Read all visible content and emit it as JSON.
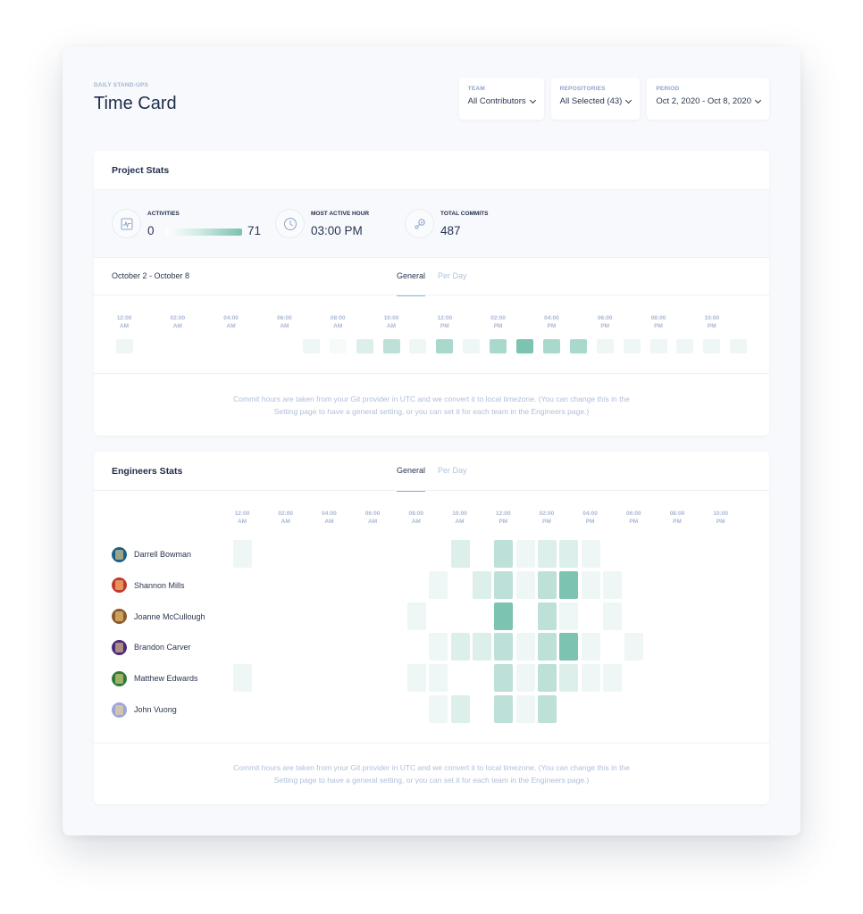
{
  "header": {
    "eyebrow": "DAILY STAND-UPS",
    "title": "Time Card"
  },
  "filters": [
    {
      "label": "TEAM",
      "value": "All Contributors",
      "icon": "chevron-down-icon"
    },
    {
      "label": "REPOSITORIES",
      "value": "All Selected (43)",
      "icon": "chevron-down-icon"
    },
    {
      "label": "PERIOD",
      "value": "Oct 2, 2020 - Oct 8, 2020",
      "icon": "chevron-down-icon"
    }
  ],
  "project_stats": {
    "title": "Project Stats",
    "stats": [
      {
        "label": "ACTIVITIES",
        "icon": "activity-icon",
        "min": "0",
        "max": "71"
      },
      {
        "label": "MOST ACTIVE HOUR",
        "icon": "clock-icon",
        "value": "03:00 PM"
      },
      {
        "label": "TOTAL COMMITS",
        "icon": "commit-icon",
        "value": "487"
      }
    ],
    "range_label": "October 2 - October 8",
    "tabs": [
      {
        "label": "General",
        "active": true
      },
      {
        "label": "Per Day",
        "active": false
      }
    ],
    "note": "Commit hours are taken from your Git provider in UTC and we convert it to local timezone. (You can change this in the Setting page to have a general setting, or you can set it for each team in the Engineers page.)"
  },
  "engineers_stats": {
    "title": "Engineers Stats",
    "tabs": [
      {
        "label": "General",
        "active": true
      },
      {
        "label": "Per Day",
        "active": false
      }
    ],
    "note": "Commit hours are taken from your Git provider in UTC and we convert it to local timezone. (You can change this in the Setting page to have a general setting, or you can set it for each team in the Engineers page.)"
  },
  "colors": {
    "accent": "#7dbbe6",
    "heat_levels": [
      "#ffffff",
      "#eef7f5",
      "#dcefeb",
      "#bde0d8",
      "#a9d8cd",
      "#7cc3b2"
    ]
  },
  "chart_data": [
    {
      "type": "heatmap",
      "title": "Project Stats — activity by hour (General)",
      "x_tick_labels": [
        [
          "12:00",
          "AM"
        ],
        [
          "02:00",
          "AM"
        ],
        [
          "04:00",
          "AM"
        ],
        [
          "06:00",
          "AM"
        ],
        [
          "08:00",
          "AM"
        ],
        [
          "10:00",
          "AM"
        ],
        [
          "12:00",
          "PM"
        ],
        [
          "02:00",
          "PM"
        ],
        [
          "04:00",
          "PM"
        ],
        [
          "06:00",
          "PM"
        ],
        [
          "08:00",
          "PM"
        ],
        [
          "10:00",
          "PM"
        ]
      ],
      "x": [
        "12 AM",
        "1 AM",
        "2 AM",
        "3 AM",
        "4 AM",
        "5 AM",
        "6 AM",
        "7 AM",
        "8 AM",
        "9 AM",
        "10 AM",
        "11 AM",
        "12 PM",
        "1 PM",
        "2 PM",
        "3 PM",
        "4 PM",
        "5 PM",
        "6 PM",
        "7 PM",
        "8 PM",
        "9 PM",
        "10 PM",
        "11 PM"
      ],
      "level_scale": "0 (none) to 5 (max activity, 71)",
      "values": [
        1,
        0,
        0,
        0,
        0,
        0,
        0,
        1,
        0.5,
        1.5,
        3,
        1,
        3.5,
        1,
        3.5,
        5,
        4,
        3.5,
        1,
        1,
        1,
        1,
        1,
        1
      ]
    },
    {
      "type": "heatmap",
      "title": "Engineers Stats — activity by hour (General)",
      "x_tick_labels": [
        [
          "12:00",
          "AM"
        ],
        [
          "02:00",
          "AM"
        ],
        [
          "04:00",
          "AM"
        ],
        [
          "06:00",
          "AM"
        ],
        [
          "08:00",
          "AM"
        ],
        [
          "10:00",
          "AM"
        ],
        [
          "12:00",
          "PM"
        ],
        [
          "02:00",
          "PM"
        ],
        [
          "04:00",
          "PM"
        ],
        [
          "06:00",
          "PM"
        ],
        [
          "08:00",
          "PM"
        ],
        [
          "10:00",
          "PM"
        ]
      ],
      "level_scale": "0 (none) to 5 (max activity)",
      "series": [
        {
          "name": "Darrell Bowman",
          "avatar": "#1f5f86",
          "values": [
            1,
            0,
            0,
            0,
            0,
            0,
            0,
            0,
            0,
            0,
            2,
            0,
            3,
            1,
            2,
            2,
            1,
            0,
            0,
            0,
            0,
            0,
            0,
            0
          ]
        },
        {
          "name": "Shannon Mills",
          "avatar": "#c0392b",
          "values": [
            0,
            0,
            0,
            0,
            0,
            0,
            0,
            0,
            0,
            1,
            0,
            2,
            3,
            1,
            3,
            5,
            1,
            1,
            0,
            0,
            0,
            0,
            0,
            0
          ]
        },
        {
          "name": "Joanne McCullough",
          "avatar": "#8b5a2b",
          "values": [
            0,
            0,
            0,
            0,
            0,
            0,
            0,
            0,
            1,
            0,
            0,
            0,
            5,
            0,
            3,
            1,
            0,
            1,
            0,
            0,
            0,
            0,
            0,
            0
          ]
        },
        {
          "name": "Brandon Carver",
          "avatar": "#4b2a7a",
          "values": [
            0,
            0,
            0,
            0,
            0,
            0,
            0,
            0,
            0,
            1,
            2,
            2,
            3,
            1,
            3,
            5,
            1,
            0,
            1,
            0,
            0,
            0,
            0,
            0
          ]
        },
        {
          "name": "Matthew Edwards",
          "avatar": "#2f7a3a",
          "values": [
            1,
            0,
            0,
            0,
            0,
            0,
            0,
            0,
            1,
            1,
            0,
            0,
            3,
            1,
            3,
            2,
            1,
            1,
            0,
            0,
            0,
            0,
            0,
            0
          ]
        },
        {
          "name": "John Vuong",
          "avatar": "#9aa6d8",
          "values": [
            0,
            0,
            0,
            0,
            0,
            0,
            0,
            0,
            0,
            1,
            2,
            0,
            3,
            1,
            3,
            0,
            0,
            0,
            0,
            0,
            0,
            0,
            0,
            0
          ]
        }
      ]
    }
  ]
}
